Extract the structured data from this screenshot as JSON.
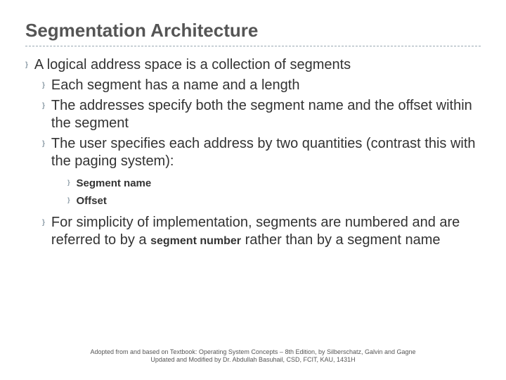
{
  "title": "Segmentation Architecture",
  "main": "A logical address space is a collection of segments",
  "sub": {
    "a": "Each segment has a name and a length",
    "b": "The addresses specify both the segment name and the offset within the segment",
    "c": "The user specifies each address by two quantities (contrast this with the paging system):",
    "d1": "Segment name",
    "d2": "Offset",
    "e_pre": "For simplicity of implementation, segments are numbered and are referred to by a ",
    "e_kw": "segment number",
    "e_post": " rather than by a segment name"
  },
  "footer": {
    "line1": "Adopted from and based on Textbook: Operating System Concepts – 8th Edition, by Silberschatz, Galvin and Gagne",
    "line2": "Updated and Modified by Dr. Abdullah Basuhail, CSD, FCIT, KAU, 1431H"
  },
  "glyph": "}"
}
